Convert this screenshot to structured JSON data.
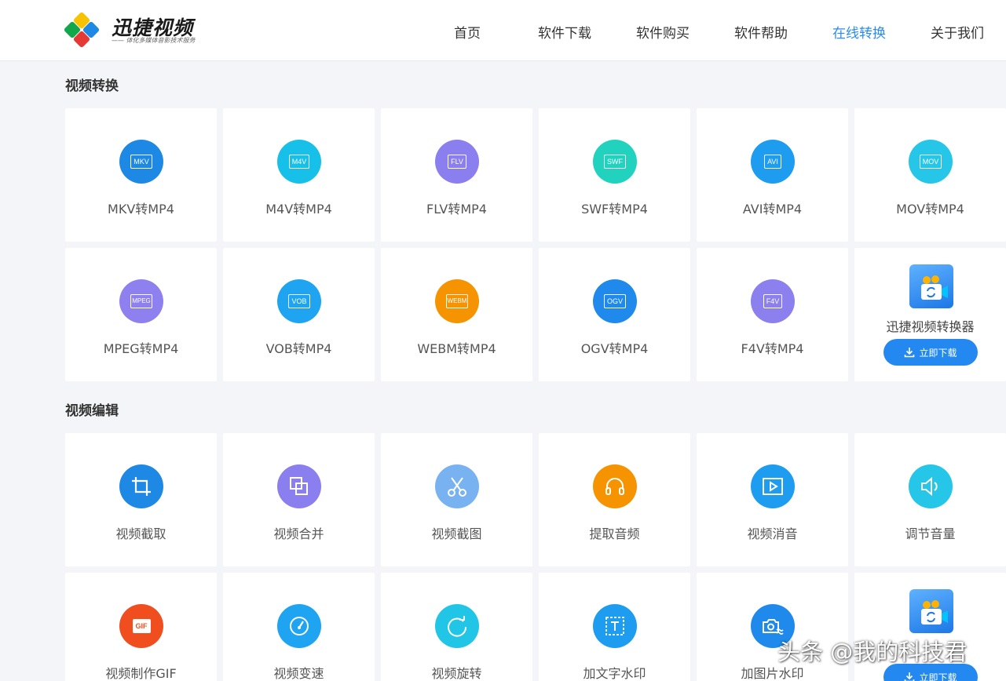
{
  "brand": {
    "name": "迅捷视频",
    "slogan": "—— 体化多媒体音影技术服务"
  },
  "nav": [
    {
      "label": "首页",
      "active": false
    },
    {
      "label": "软件下载",
      "active": false
    },
    {
      "label": "软件购买",
      "active": false
    },
    {
      "label": "软件帮助",
      "active": false
    },
    {
      "label": "在线转换",
      "active": true
    },
    {
      "label": "关于我们",
      "active": false
    }
  ],
  "sections": {
    "convert": {
      "title": "视频转换",
      "cards": [
        {
          "label": "MKV转MP4",
          "badge": "MKV",
          "color": "#1e88e5"
        },
        {
          "label": "M4V转MP4",
          "badge": "M4V",
          "color": "#17c0e8"
        },
        {
          "label": "FLV转MP4",
          "badge": "FLV",
          "color": "#8b7ff0"
        },
        {
          "label": "SWF转MP4",
          "badge": "SWF",
          "color": "#21d3be"
        },
        {
          "label": "AVI转MP4",
          "badge": "AVI",
          "color": "#1d9cf0"
        },
        {
          "label": "MOV转MP4",
          "badge": "MOV",
          "color": "#25c6e8"
        },
        {
          "label": "MPEG转MP4",
          "badge": "MPEG",
          "color": "#8e80ef"
        },
        {
          "label": "VOB转MP4",
          "badge": "VOB",
          "color": "#1ea4f0"
        },
        {
          "label": "WEBM转MP4",
          "badge": "WEBM",
          "color": "#f59300"
        },
        {
          "label": "OGV转MP4",
          "badge": "OGV",
          "color": "#1f8aeb"
        },
        {
          "label": "F4V转MP4",
          "badge": "F4V",
          "color": "#8c7fee"
        }
      ]
    },
    "edit": {
      "title": "视频编辑",
      "cards": [
        {
          "label": "视频截取",
          "icon": "crop-icon",
          "color": "#1e88e5"
        },
        {
          "label": "视频合并",
          "icon": "merge-icon",
          "color": "#8b7ff0"
        },
        {
          "label": "视频截图",
          "icon": "scissors-icon",
          "color": "#79b2f0"
        },
        {
          "label": "提取音频",
          "icon": "headphones-icon",
          "color": "#f59300"
        },
        {
          "label": "视频消音",
          "icon": "play-icon",
          "color": "#1d9cf0"
        },
        {
          "label": "调节音量",
          "icon": "speaker-icon",
          "color": "#25c6e8"
        },
        {
          "label": "视频制作GIF",
          "icon": "gif-icon",
          "color": "#f04e1e"
        },
        {
          "label": "视频变速",
          "icon": "speedometer-icon",
          "color": "#1ea4f0"
        },
        {
          "label": "视频旋转",
          "icon": "rotate-icon",
          "color": "#21c6e6"
        },
        {
          "label": "加文字水印",
          "icon": "text-watermark-icon",
          "color": "#1d9cf0"
        },
        {
          "label": "加图片水印",
          "icon": "image-watermark-icon",
          "color": "#1f8aeb"
        }
      ]
    }
  },
  "promo": {
    "label": "迅捷视频转换器",
    "button": "立即下载"
  },
  "watermark": "头条 @我的科技君"
}
